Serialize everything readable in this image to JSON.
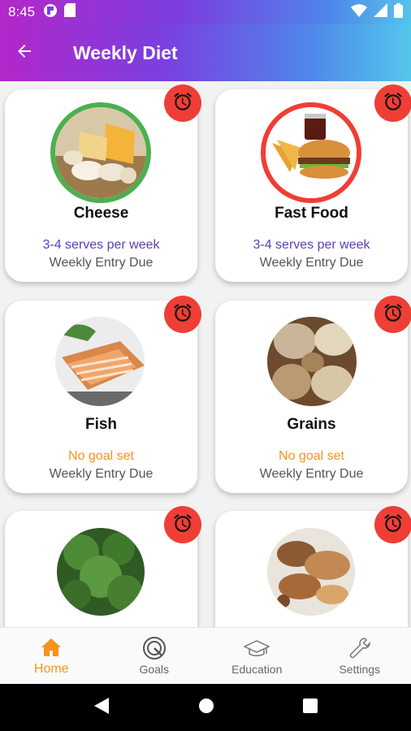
{
  "status": {
    "time": "8:45"
  },
  "header": {
    "title": "Weekly Diet"
  },
  "cards": [
    {
      "name": "Cheese",
      "goal": "3-4 serves per week",
      "goal_color": "#5a3fb8",
      "due": "Weekly Entry Due",
      "ring": "#4caf50"
    },
    {
      "name": "Fast Food",
      "goal": "3-4 serves per week",
      "goal_color": "#5a3fb8",
      "due": "Weekly Entry Due",
      "ring": "#ef3e36"
    },
    {
      "name": "Fish",
      "goal": "No goal set",
      "goal_color": "#f7931e",
      "due": "Weekly Entry Due"
    },
    {
      "name": "Grains",
      "goal": "No goal set",
      "goal_color": "#f7931e",
      "due": "Weekly Entry Due"
    },
    {
      "name": "",
      "goal": "",
      "due": ""
    },
    {
      "name": "",
      "goal": "",
      "due": ""
    }
  ],
  "nav": {
    "items": [
      {
        "label": "Home",
        "icon": "home-icon"
      },
      {
        "label": "Goals",
        "icon": "target-icon"
      },
      {
        "label": "Education",
        "icon": "graduation-cap-icon"
      },
      {
        "label": "Settings",
        "icon": "wrench-icon"
      }
    ],
    "active_color": "#f7931e"
  },
  "colors": {
    "alarm": "#ef3e36"
  }
}
